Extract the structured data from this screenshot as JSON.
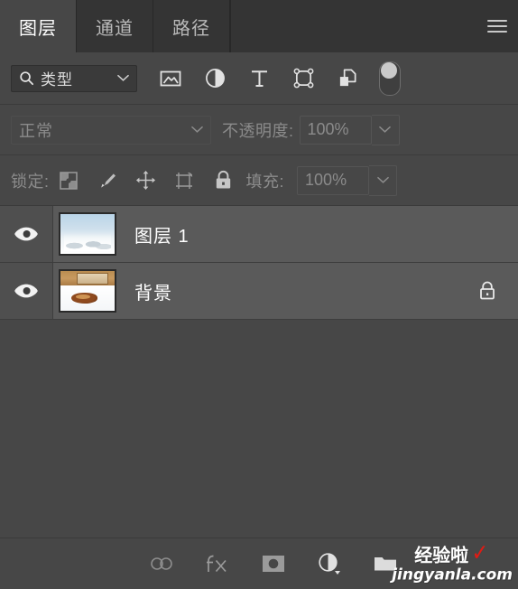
{
  "panel": {
    "title": "图层",
    "tabs": [
      {
        "label": "图层",
        "active": true
      },
      {
        "label": "通道",
        "active": false
      },
      {
        "label": "路径",
        "active": false
      }
    ],
    "menu_icon": "hamburger-menu-icon"
  },
  "filter": {
    "select_label": "类型",
    "search_icon": "search-icon",
    "chevron_icon": "chevron-down-icon",
    "type_icons": [
      {
        "name": "pixel-layer-filter-icon",
        "title": "像素图层"
      },
      {
        "name": "adjustment-layer-filter-icon",
        "title": "调整图层"
      },
      {
        "name": "type-layer-filter-icon",
        "title": "文字图层"
      },
      {
        "name": "shape-layer-filter-icon",
        "title": "形状图层"
      },
      {
        "name": "smart-object-filter-icon",
        "title": "智能对象"
      }
    ],
    "toggle": {
      "name": "filter-enable-toggle",
      "state": "off"
    }
  },
  "blend": {
    "mode": "正常",
    "mode_chevron_icon": "chevron-down-icon",
    "opacity_label": "不透明度:",
    "opacity_value": "100%",
    "opacity_stepper_icon": "chevron-down-icon"
  },
  "lock": {
    "label": "锁定:",
    "icons": [
      {
        "name": "lock-transparent-pixels-icon",
        "title": "锁定透明像素"
      },
      {
        "name": "lock-image-pixels-icon",
        "title": "锁定图像像素"
      },
      {
        "name": "lock-position-icon",
        "title": "锁定位置"
      },
      {
        "name": "lock-artboard-nesting-icon",
        "title": "防止在画板内外自动嵌套"
      },
      {
        "name": "lock-all-icon",
        "title": "锁定全部"
      }
    ],
    "fill_label": "填充:",
    "fill_value": "100%",
    "fill_stepper_icon": "chevron-down-icon"
  },
  "layers": [
    {
      "name": "图层 1",
      "visible": true,
      "eye_icon": "eye-icon",
      "thumbnail": "snow-sky-thumbnail",
      "locked": false,
      "selected": true
    },
    {
      "name": "背景",
      "visible": true,
      "eye_icon": "eye-icon",
      "thumbnail": "snow-animal-thumbnail",
      "locked": true,
      "lock_icon": "lock-icon",
      "selected": true
    }
  ],
  "bottom_toolbar": [
    {
      "name": "link-layers-icon",
      "title": "链接图层",
      "enabled": false
    },
    {
      "name": "layer-style-fx-icon",
      "title": "添加图层样式",
      "enabled": false
    },
    {
      "name": "add-layer-mask-icon",
      "title": "添加图层蒙版",
      "enabled": true
    },
    {
      "name": "new-adjustment-layer-icon",
      "title": "创建新的填充或调整图层",
      "enabled": true
    },
    {
      "name": "new-group-icon",
      "title": "创建新组",
      "enabled": true
    }
  ],
  "watermark": {
    "brand": "经验啦",
    "check": "✓",
    "url": "jingyanla.com"
  },
  "colors": {
    "panel_bg": "#474747",
    "tabbar_bg": "#343434",
    "row_selected": "#5a5a5a",
    "text_primary": "#ffffff",
    "text_dim": "#8b8b8b",
    "watermark_check": "#e01b14"
  }
}
